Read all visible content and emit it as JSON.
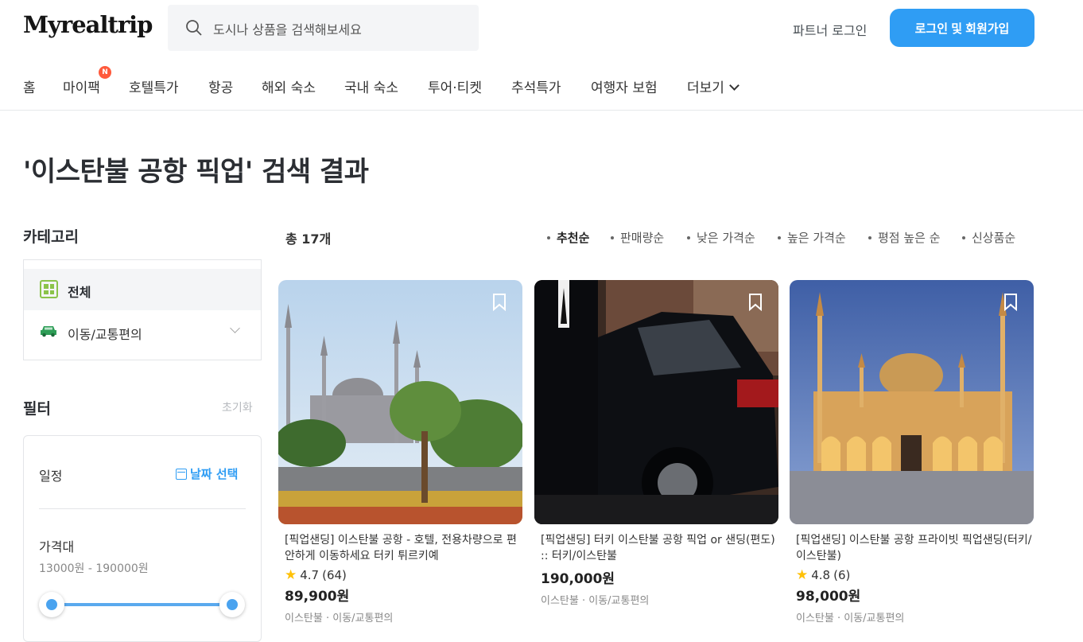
{
  "header": {
    "logo": "Myrealtrip",
    "search_placeholder": "도시나 상품을 검색해보세요",
    "partner_login": "파트너 로그인",
    "login_signup": "로그인 및 회원가입"
  },
  "nav": {
    "items": [
      "홈",
      "마이팩",
      "호텔특가",
      "항공",
      "해외 숙소",
      "국내 숙소",
      "투어·티켓",
      "추석특가",
      "여행자 보험",
      "더보기"
    ],
    "new_badge": "N"
  },
  "page": {
    "title": "'이스탄불 공항 픽업' 검색 결과"
  },
  "sidebar": {
    "category_title": "카테고리",
    "categories": [
      "전체",
      "이동/교통편의"
    ],
    "filter_title": "필터",
    "filter_reset": "초기화",
    "date_label": "일정",
    "date_button": "날짜 선택",
    "price_label": "가격대",
    "price_range": "13000원 - 190000원"
  },
  "results": {
    "total": "총 17개",
    "sort_options": [
      "추천순",
      "판매량순",
      "낮은 가격순",
      "높은 가격순",
      "평점 높은 순",
      "신상품순"
    ],
    "cards": [
      {
        "title": "[픽업샌딩] 이스탄불 공항 - 호텔, 전용차량으로 편안하게 이동하세요 터키 튀르키예",
        "rating": "4.7",
        "reviews": "(64)",
        "price": "89,900원",
        "meta": "이스탄불 · 이동/교통편의"
      },
      {
        "title": "[픽업샌딩] 터키 이스탄불 공항 픽업 or 샌딩(편도) :: 터키/이스탄불",
        "rating": "",
        "reviews": "",
        "price": "190,000원",
        "meta": "이스탄불 · 이동/교통편의"
      },
      {
        "title": "[픽업샌딩] 이스탄불 공항 프라이빗 픽업샌딩(터키/이스탄불)",
        "rating": "4.8",
        "reviews": "(6)",
        "price": "98,000원",
        "meta": "이스탄불 · 이동/교통편의"
      }
    ]
  },
  "colors": {
    "primary": "#2f9df4",
    "badge": "#ff5a3c",
    "star": "#ffc107"
  }
}
